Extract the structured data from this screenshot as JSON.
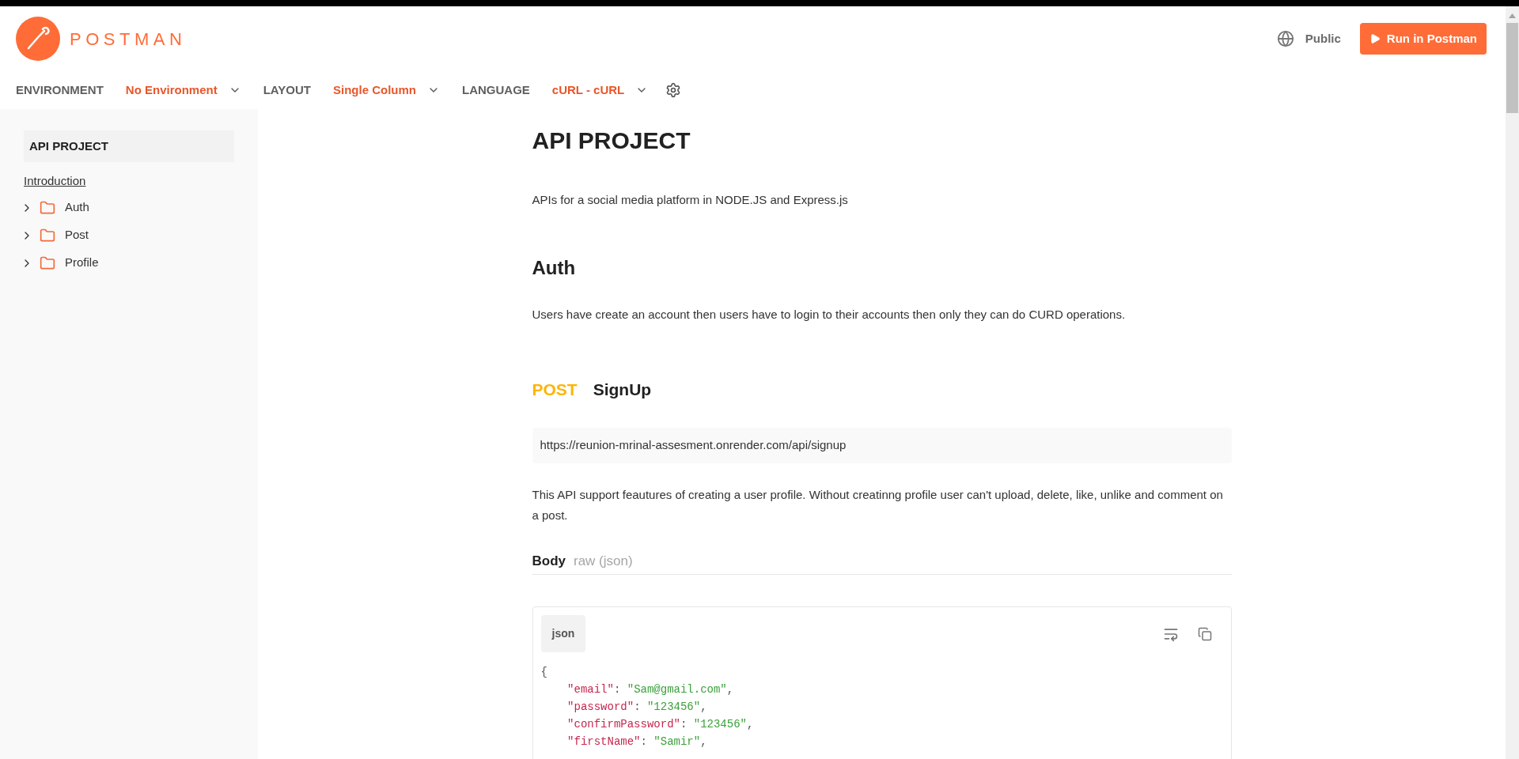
{
  "header": {
    "brand": "POSTMAN",
    "visibility": "Public",
    "run_button": "Run in Postman"
  },
  "toolbar": [
    {
      "label": "ENVIRONMENT",
      "value": "No Environment"
    },
    {
      "label": "LAYOUT",
      "value": "Single Column"
    },
    {
      "label": "LANGUAGE",
      "value": "cURL - cURL"
    }
  ],
  "sidebar": {
    "title": "API PROJECT",
    "intro_link": "Introduction",
    "items": [
      {
        "label": "Auth",
        "expanded": false
      },
      {
        "label": "Post",
        "expanded": false
      },
      {
        "label": "Profile",
        "expanded": false
      }
    ]
  },
  "content": {
    "title": "API PROJECT",
    "description": "APIs for a social media platform in NODE.JS and Express.js",
    "folder": {
      "title": "Auth",
      "description": "Users have create an account then users have to login to their accounts then only they can do CURD operations."
    },
    "request": {
      "method": "POST",
      "name": "SignUp",
      "url": "https://reunion-mrinal-assesment.onrender.com/api/signup",
      "description": "This API support feautures of creating a user profile. Without creatinng profile user can't upload, delete, like, unlike and comment on a post.",
      "body_label": "Body",
      "body_type": "raw (json)",
      "code": {
        "language": "json",
        "lines": [
          {
            "tokens": [
              {
                "kind": "punct",
                "text": "{"
              }
            ]
          },
          {
            "tokens": [
              {
                "kind": "key",
                "text": "    \"email\""
              },
              {
                "kind": "punct",
                "text": ": "
              },
              {
                "kind": "string",
                "text": "\"Sam@gmail.com\""
              },
              {
                "kind": "punct",
                "text": ","
              }
            ]
          },
          {
            "tokens": [
              {
                "kind": "key",
                "text": "    \"password\""
              },
              {
                "kind": "punct",
                "text": ": "
              },
              {
                "kind": "string",
                "text": "\"123456\""
              },
              {
                "kind": "punct",
                "text": ","
              }
            ]
          },
          {
            "tokens": [
              {
                "kind": "key",
                "text": "    \"confirmPassword\""
              },
              {
                "kind": "punct",
                "text": ": "
              },
              {
                "kind": "string",
                "text": "\"123456\""
              },
              {
                "kind": "punct",
                "text": ","
              }
            ]
          },
          {
            "tokens": [
              {
                "kind": "key",
                "text": "    \"firstName\""
              },
              {
                "kind": "punct",
                "text": ": "
              },
              {
                "kind": "string",
                "text": "\"Samir\""
              },
              {
                "kind": "punct",
                "text": ","
              }
            ]
          }
        ]
      }
    }
  }
}
